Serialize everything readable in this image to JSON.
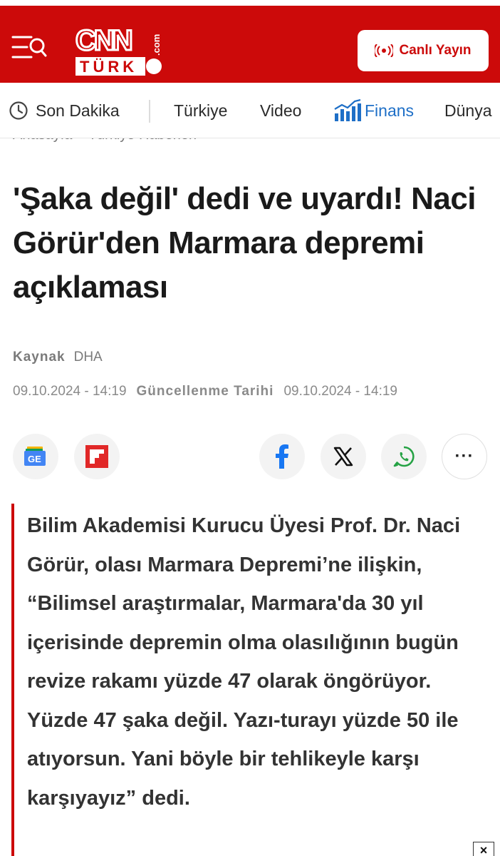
{
  "header": {
    "logo_cnn": "CNN",
    "logo_turk": "TÜRK",
    "logo_com": ".com",
    "live_label": "Canlı Yayın"
  },
  "nav": {
    "items": [
      "Son Dakika",
      "Türkiye",
      "Video",
      "Finans",
      "Dünya"
    ]
  },
  "breadcrumb": "Anasayfa  >  Türkiye Haberleri",
  "article": {
    "title": "'Şaka değil' dedi ve uyardı! Naci Görür'den Marmara depremi açıklaması",
    "source_label": "Kaynak",
    "source_value": "DHA",
    "published": "09.10.2024 - 14:19",
    "updated_label": "Güncellenme Tarihi",
    "updated": "09.10.2024 - 14:19",
    "summary": "Bilim Akademisi Kurucu Üyesi Prof. Dr. Naci Görür, olası Marmara Depremi’ne ilişkin, “Bilimsel araştırmalar, Marmara'da 30 yıl içerisinde depremin olma olasılığının bugün revize rakamı yüzde 47 olarak öngörüyor. Yüzde 47 şaka değil. Yazı-turayı yüzde 50 ile atıyorsun. Yani böyle bir tehlikeyle karşı karşıyayız” dedi."
  },
  "share": {
    "google_news_text": "GE",
    "more_text": "···"
  },
  "ad": {
    "close_text": "×"
  },
  "colors": {
    "brand_red": "#cc0a0a",
    "finans_blue": "#1e6fc7"
  }
}
